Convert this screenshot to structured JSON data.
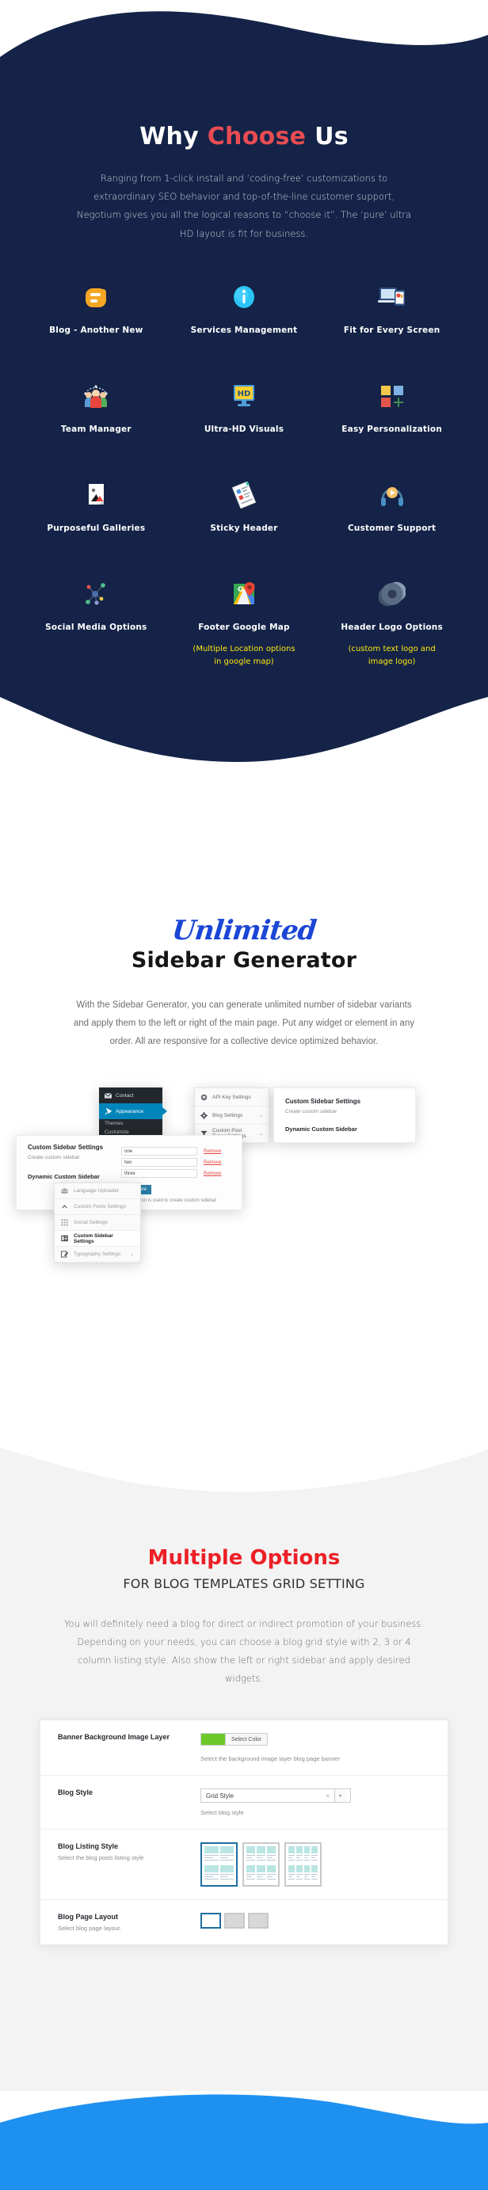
{
  "colors": {
    "dark_navy": "#142347",
    "accent_red": "#e84c52",
    "yellow_note": "#ffe813",
    "script_blue": "#1b46d6",
    "heading_red": "#ec2026",
    "wp_blue": "#0085ba",
    "footer_blue": "#1e90f0",
    "swatch_green": "#6ec82a"
  },
  "why": {
    "title_part1": "Why ",
    "title_accent": "Choose",
    "title_part2": " Us",
    "paragraph": "Ranging from 1-click install and ‘coding-free’ customizations to extraordinary SEO behavior and top-of-the-line customer support, Negotium gives you all the logical reasons to “choose it”. The ‘pure’ ultra HD layout is fit for business.",
    "features": [
      {
        "icon": "blogger-icon",
        "label": "Blog - Another New",
        "note": ""
      },
      {
        "icon": "info-circle-icon",
        "label": "Services Management",
        "note": ""
      },
      {
        "icon": "responsive-devices-icon",
        "label": "Fit for Every Screen",
        "note": ""
      },
      {
        "icon": "team-people-icon",
        "label": "Team Manager",
        "note": ""
      },
      {
        "icon": "hd-monitor-icon",
        "label": "Ultra-HD Visuals",
        "note": ""
      },
      {
        "icon": "color-squares-plus-icon",
        "label": "Easy Personalization",
        "note": ""
      },
      {
        "icon": "gallery-image-icon",
        "label": "Purposeful Galleries",
        "note": ""
      },
      {
        "icon": "sticky-note-icon",
        "label": "Sticky Header",
        "note": ""
      },
      {
        "icon": "headset-support-icon",
        "label": "Customer Support",
        "note": ""
      },
      {
        "icon": "social-network-icon",
        "label": "Social Media Options",
        "note": ""
      },
      {
        "icon": "google-map-pin-icon",
        "label": "Footer Google Map",
        "note": "(Multiple Location options in google map)"
      },
      {
        "icon": "logo-swirl-icon",
        "label": "Header Logo Options",
        "note": "(custom text logo and image logo)"
      }
    ]
  },
  "sidebar_generator": {
    "script_word": "Unlimited",
    "heading": "Sidebar Generator",
    "paragraph": "With the Sidebar Generator, you can generate unlimited number of sidebar variants and apply them to the left or right of the main page. Put any widget or element in any order. All are responsive for a collective device optimized behavior.",
    "wp_menu": {
      "items": [
        {
          "icon": "mail-icon",
          "label": "Contact",
          "active": false
        },
        {
          "icon": "pin-icon",
          "label": "Appearance",
          "active": true
        }
      ],
      "submenu": [
        "Themes",
        "Customize"
      ]
    },
    "settings_menu": [
      {
        "icon": "key-icon",
        "label": "API Key Settings",
        "chevron": ""
      },
      {
        "icon": "gear-icon",
        "label": "Blog Settings",
        "chevron": "⌄"
      },
      {
        "icon": "filter-icon",
        "label": "Custom Post Types Settings",
        "chevron": "⌄"
      }
    ],
    "panel_back": {
      "heading": "Custom Sidebar Settings",
      "subtext": "Create custom sidebar",
      "field_label": "Dynamic Custom Sidebar"
    },
    "panel_front": {
      "heading": "Custom Sidebar Settings",
      "subtext": "Create custom sidebar",
      "field_label": "Dynamic Custom Sidebar",
      "rows": [
        {
          "value": "one",
          "remove_label": "Remove"
        },
        {
          "value": "two",
          "remove_label": "Remove"
        },
        {
          "value": "three",
          "remove_label": "Remove"
        }
      ],
      "add_more_label": "Add More",
      "note": "This section is used to create custom sidebar"
    },
    "context_menu": [
      {
        "icon": "toolbox-icon",
        "label": "Language Uploader",
        "chevron": "",
        "selected": false
      },
      {
        "icon": "caret-up-icon",
        "label": "Custom Fonts Settings",
        "chevron": "",
        "selected": false
      },
      {
        "icon": "dots-grid-icon",
        "label": "Social Settings",
        "chevron": "",
        "selected": false
      },
      {
        "icon": "sidebar-list-icon",
        "label": "Custom Sidebar Settings",
        "chevron": "",
        "selected": true
      },
      {
        "icon": "pencil-square-icon",
        "label": "Typography Settings",
        "chevron": "⌄",
        "selected": false
      }
    ]
  },
  "multiple_options": {
    "title": "Multiple Options",
    "subtitle": "FOR BLOG TEMPLATES GRID SETTING",
    "paragraph": "You will definitely need a blog for direct or indirect promotion of your business. Depending on your needs, you can choose a blog grid style with 2, 3 or 4 column listing style. Also show the left or right sidebar and apply desired widgets.",
    "rows": [
      {
        "label": "Banner Background Image Layer",
        "sublabel": "",
        "control": "color",
        "color_value": "#6ec82a",
        "color_button_label": "Select Color",
        "help": "Select the background image layer blog page banner"
      },
      {
        "label": "Blog Style",
        "sublabel": "",
        "control": "select",
        "selected_option": "Grid Style",
        "clear_glyph": "×",
        "arrow_glyph": "▾",
        "help": "Select blog style"
      },
      {
        "label": "Blog Listing Style",
        "sublabel": "Select the blog posts listing style",
        "control": "thumbs",
        "thumb_columns": [
          2,
          3,
          4
        ],
        "selected_index": 0,
        "help": ""
      },
      {
        "label": "Blog Page Layout",
        "sublabel": "Select blog page layout.",
        "control": "layouts",
        "layout_count": 3,
        "selected_index": 0,
        "help": ""
      }
    ]
  }
}
